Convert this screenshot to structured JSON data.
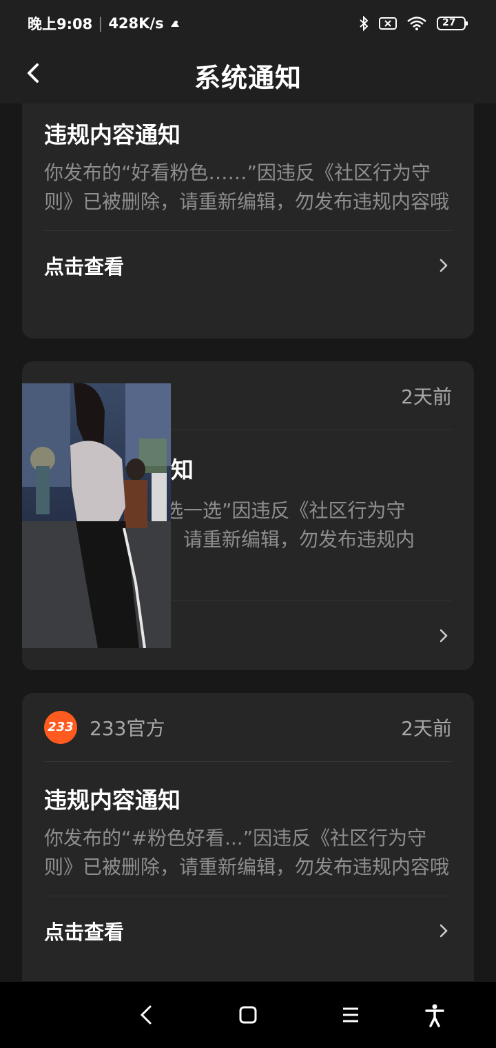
{
  "status_bar": {
    "time": "晚上9:08",
    "speed": "428K/s",
    "battery": "27",
    "icons": [
      "notification-icon",
      "bluetooth-icon",
      "sim-off-icon",
      "wifi-icon",
      "battery-icon"
    ]
  },
  "header": {
    "title": "系统通知"
  },
  "notifications": [
    {
      "title": "违规内容通知",
      "body": "你发布的“好看粉色……”因违反《社区行为守则》已被删除，请重新编辑，勿发布违规内容哦",
      "action": "点击查看"
    },
    {
      "time": "2天前",
      "title_visible": "知",
      "body_line1_visible": "选一选”因违反《社区行为守",
      "body_line2_visible": "，请重新编辑，勿发布违规内"
    },
    {
      "sender": "233官方",
      "sender_logo": "233",
      "time": "2天前",
      "title": "违规内容通知",
      "body": "你发布的“#粉色好看...”因违反《社区行为守则》已被删除，请重新编辑，勿发布违规内容哦",
      "action": "点击查看"
    }
  ],
  "nav_bar": {
    "icons": [
      "back-icon",
      "home-icon",
      "menu-icon",
      "accessibility-icon"
    ]
  },
  "colors": {
    "background": "#181818",
    "card": "#262626",
    "accent_logo": "#ff5a1f",
    "secondary_text": "#8e8e8e"
  }
}
